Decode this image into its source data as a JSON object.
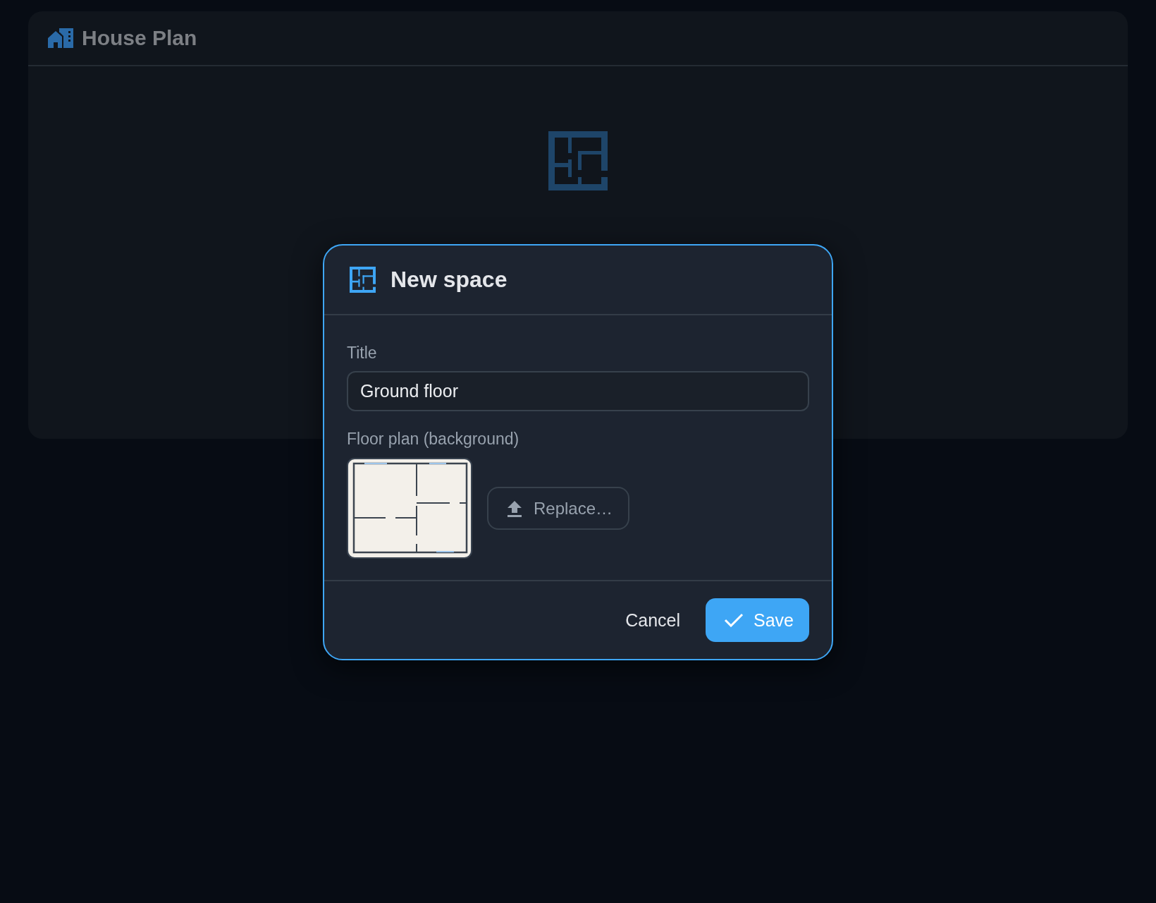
{
  "app": {
    "title": "House Plan"
  },
  "dialog": {
    "title": "New space",
    "title_field": {
      "label": "Title",
      "value": "Ground floor"
    },
    "floor_plan": {
      "label": "Floor plan (background)",
      "replace_button": "Replace…"
    },
    "buttons": [
      {
        "label": "Cancel",
        "kind": "secondary"
      },
      {
        "label": "Save",
        "kind": "primary"
      }
    ]
  }
}
